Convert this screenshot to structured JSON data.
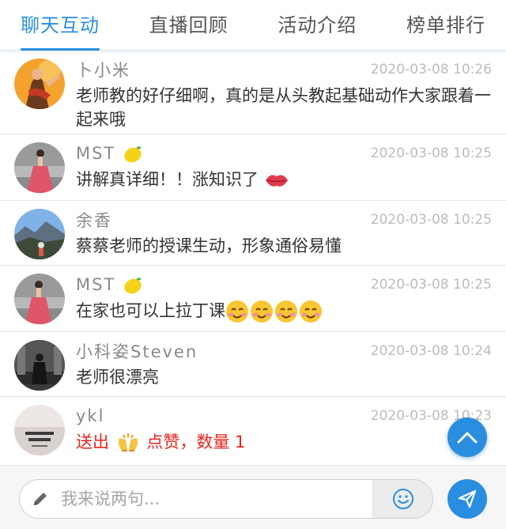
{
  "tabs": [
    {
      "label": "聊天互动",
      "active": true
    },
    {
      "label": "直播回顾",
      "active": false
    },
    {
      "label": "活动介绍",
      "active": false
    },
    {
      "label": "榜单排行",
      "active": false
    }
  ],
  "messages": [
    {
      "name": "卜小米",
      "time": "2020-03-08 10:26",
      "text": "老师教的好仔细啊，真的是从头教起基础动作大家跟着一起来哦"
    },
    {
      "name": "MST",
      "name_emoji": "lemon-emoji",
      "time": "2020-03-08 10:25",
      "text": "讲解真详细！！涨知识了",
      "text_emoji": "kiss-lips-emoji"
    },
    {
      "name": "余香",
      "time": "2020-03-08 10:25",
      "text": "蔡蔡老师的授课生动，形象通俗易懂"
    },
    {
      "name": "MST",
      "name_emoji": "lemon-emoji",
      "time": "2020-03-08 10:25",
      "text": "在家也可以上拉丁课",
      "text_emoji": "blushing-smile-emoji x4"
    },
    {
      "name": "小科姿Steven",
      "time": "2020-03-08 10:24",
      "text": "老师很漂亮"
    },
    {
      "name": "ykl",
      "time": "2020-03-08 10:23",
      "gift_prefix": "送出",
      "gift_icon": "clapping-hands-emoji",
      "gift_suffix": "点赞，数量 1"
    }
  ],
  "input": {
    "placeholder": "我来说两句..."
  },
  "icons": {
    "pencil": "pencil-icon",
    "emoji": "smiley-icon",
    "send": "paper-plane-icon",
    "scroll_top": "chevron-up-icon"
  },
  "colors": {
    "accent": "#2a8ee0",
    "gift_text": "#e8261c"
  }
}
